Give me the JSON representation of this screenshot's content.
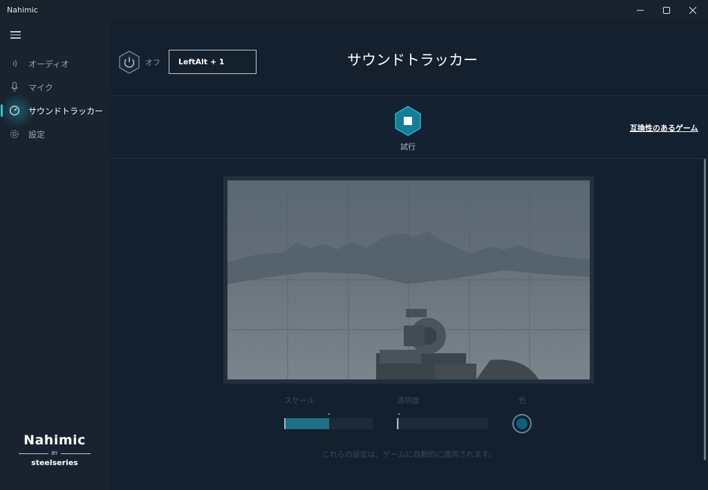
{
  "window": {
    "title": "Nahimic",
    "minimize_glyph": "—",
    "maximize_glyph": "☐",
    "close_glyph": "✕"
  },
  "sidebar": {
    "menu_icon": "hamburger-icon",
    "items": [
      {
        "label": "オーディオ",
        "icon": "audio-waves-icon",
        "active": false
      },
      {
        "label": "マイク",
        "icon": "microphone-icon",
        "active": false
      },
      {
        "label": "サウンドトラッカー",
        "icon": "compass-icon",
        "active": true
      },
      {
        "label": "設定",
        "icon": "gear-icon",
        "active": false
      }
    ],
    "logo": {
      "name": "Nahimic",
      "by": "BY",
      "brand": "steelseries"
    }
  },
  "header": {
    "power_state": "オフ",
    "hotkey": "LeftAlt + 1",
    "title": "サウンドトラッカー"
  },
  "test": {
    "label": "試行",
    "compat_link": "互換性のあるゲーム"
  },
  "controls": {
    "scale_label": "スケール",
    "scale_value": 0.51,
    "opacity_label": "透明度",
    "opacity_value": 0.02,
    "color_label": "色",
    "color_value": "#0f5f7a"
  },
  "note": "これらの設定は、ゲームに自動的に適用されます。",
  "colors": {
    "accent": "#2fc6dc",
    "background": "#13202e",
    "sidebar": "#18232f"
  }
}
